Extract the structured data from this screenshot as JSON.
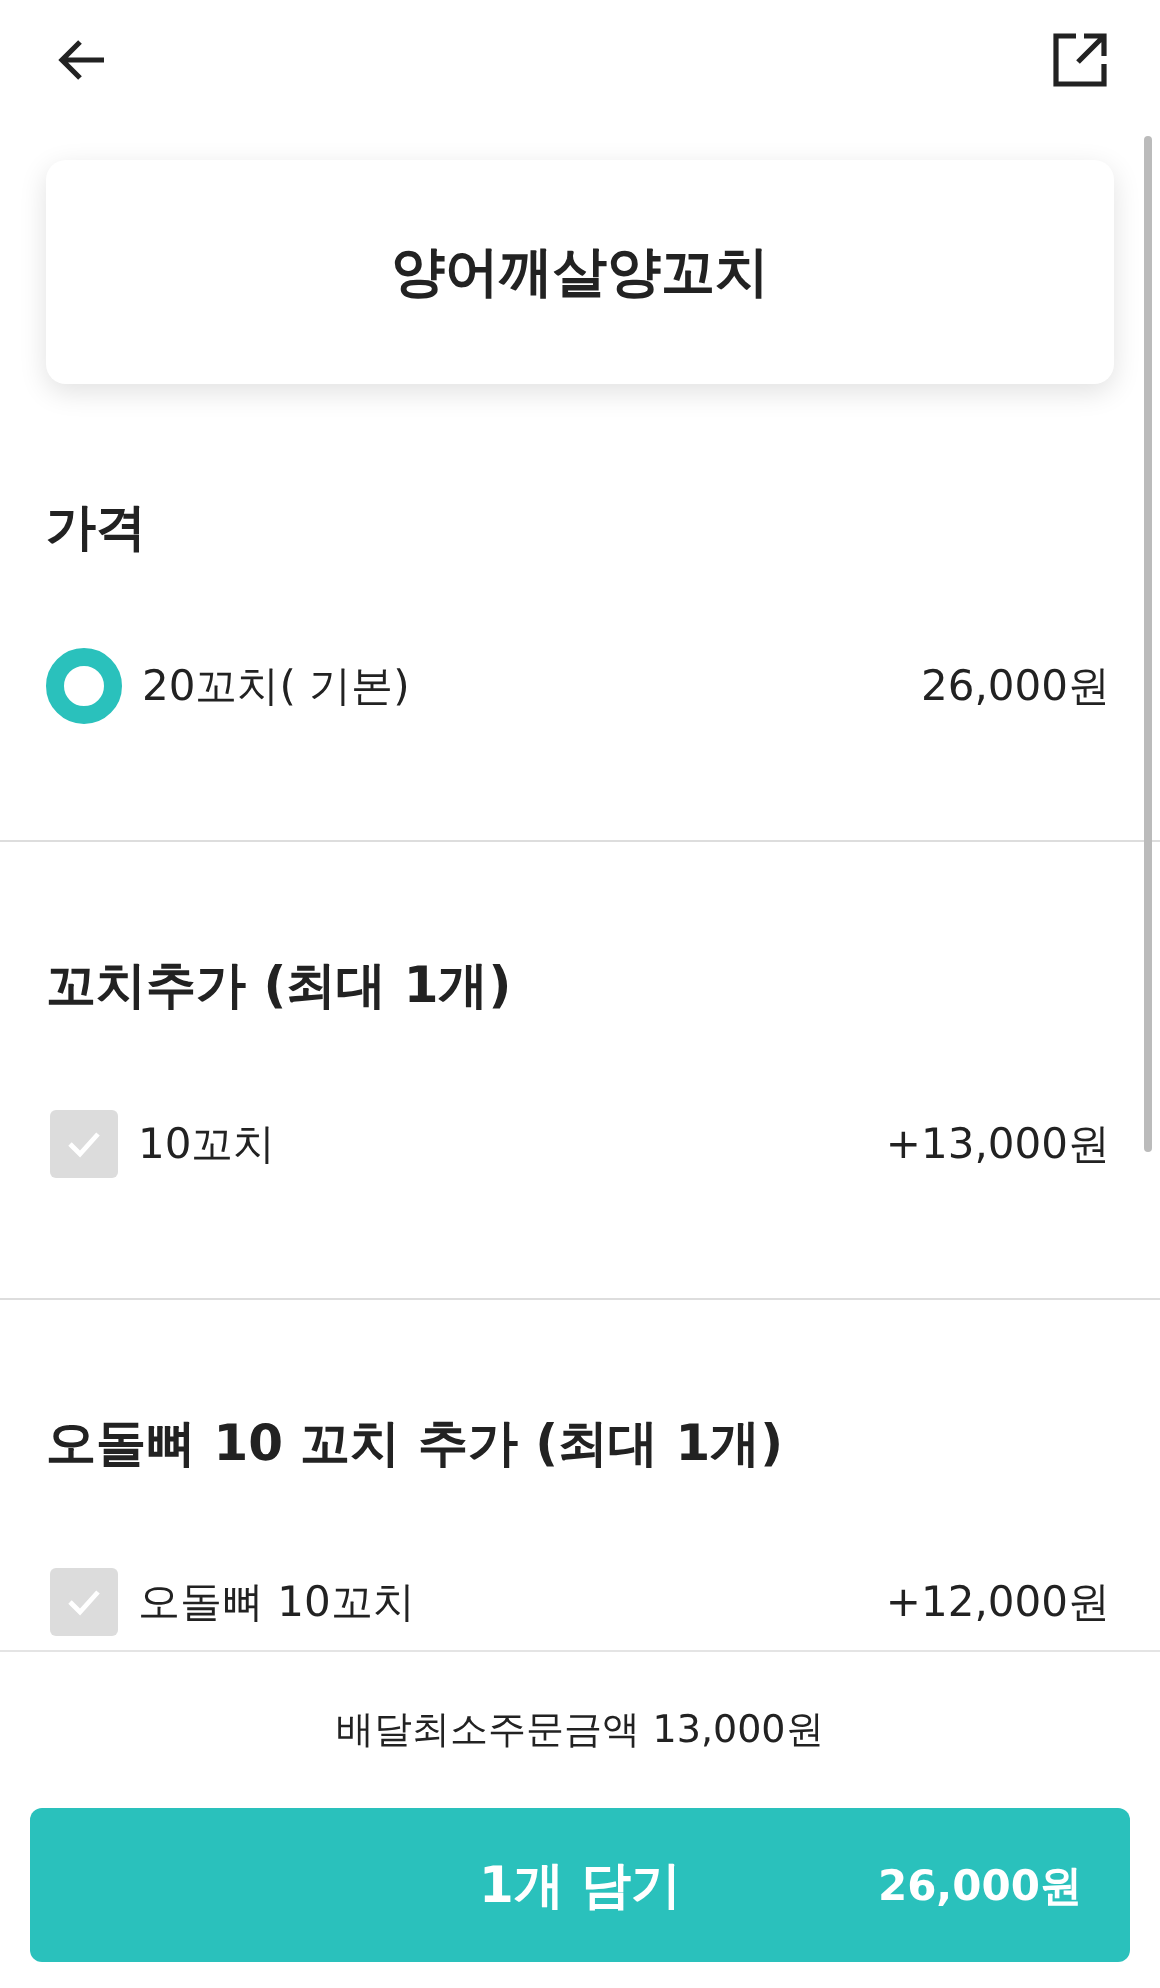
{
  "title": "양어깨살양꼬치",
  "sections": [
    {
      "title": "가격",
      "options": [
        {
          "kind": "radio",
          "label": "20꼬치( 기본)",
          "price": "26,000원",
          "selected": true
        }
      ]
    },
    {
      "title": "꼬치추가 (최대 1개)",
      "options": [
        {
          "kind": "checkbox",
          "label": "10꼬치",
          "price": "+13,000원",
          "checked": false
        }
      ]
    },
    {
      "title": "오돌뼈 10 꼬치 추가 (최대 1개)",
      "options": [
        {
          "kind": "checkbox",
          "label": "오돌뼈 10꼬치",
          "price": "+12,000원",
          "checked": false
        }
      ]
    }
  ],
  "footer": {
    "min_order": "배달최소주문금액 13,000원",
    "button_label": "1개 담기",
    "button_price": "26,000원"
  }
}
